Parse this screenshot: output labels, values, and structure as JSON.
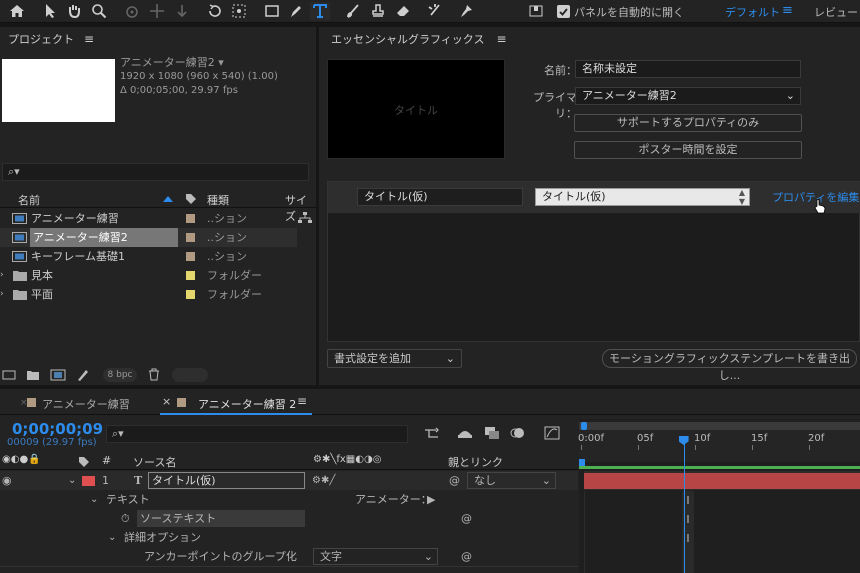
{
  "toolbar": {
    "auto_open_label": "パネルを自動的に開く",
    "workspace_default": "デフォルト",
    "workspace_review": "レビュー"
  },
  "project": {
    "header": "プロジェクト",
    "comp_name": "アニメーター練習2 ▾",
    "comp_info1": "1920 x 1080  (960 x 540) (1.00)",
    "comp_info2": "Δ 0;00;05;00, 29.97 fps",
    "search_placeholder": "",
    "col_name": "名前",
    "col_type": "種類",
    "col_size": "サイズ",
    "items": [
      {
        "name": "アニメーター練習",
        "type": "..ション",
        "color": "#b09a82",
        "kind": "comp"
      },
      {
        "name": "アニメーター練習2",
        "type": "..ション",
        "color": "#b09a82",
        "kind": "comp"
      },
      {
        "name": "キーフレーム基礎1",
        "type": "..ション",
        "color": "#b09a82",
        "kind": "comp"
      },
      {
        "name": "見本",
        "type": "フォルダー",
        "color": "#e4d76e",
        "kind": "folder"
      },
      {
        "name": "平面",
        "type": "フォルダー",
        "color": "#e4d76e",
        "kind": "folder"
      }
    ],
    "bpc": "8 bpc"
  },
  "eg": {
    "header": "エッセンシャルグラフィックス",
    "preview_text": "タイトル",
    "name_label": "名前：",
    "name_value": "名称未設定",
    "primary_label": "プライマリ：",
    "primary_value": "アニメーター練習2",
    "btn_supported": "サポートするプロパティのみ",
    "btn_poster": "ポスター時間を設定",
    "prop_label": "タイトル(仮)",
    "prop_value": "タイトル(仮)",
    "edit_props": "プロパティを編集",
    "add_format": "書式設定を追加",
    "export_btn": "モーショングラフィックステンプレートを書き出し..."
  },
  "timeline": {
    "tab1": "アニメーター練習",
    "tab2": "アニメーター練習 2",
    "timecode": "0;00;00;09",
    "frame_info": "00009 (29.97 fps)",
    "col_num": "#",
    "col_source": "ソース名",
    "col_parent": "親とリンク",
    "layer_num": "1",
    "layer_name": "タイトル(仮)",
    "parent_value": "なし",
    "text_group": "テキスト",
    "animator": "アニメーター：",
    "source_text": "ソーステキスト",
    "advanced": "詳細オプション",
    "anchor_group": "アンカーポイントのグループ化",
    "anchor_value": "文字",
    "ruler": [
      "0:00f",
      "05f",
      "10f",
      "15f",
      "20f",
      "2"
    ],
    "playhead_frame": 9
  },
  "colors": {
    "accent": "#2d8ceb",
    "layer_red": "#e05050",
    "bar_red": "#b84545",
    "work_green": "#4caf50"
  }
}
